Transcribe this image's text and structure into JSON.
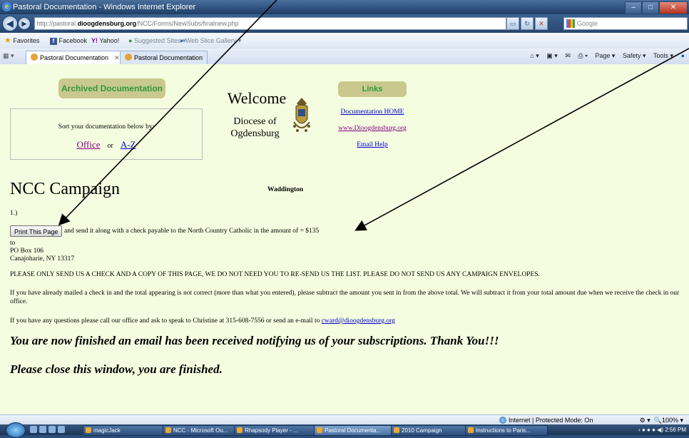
{
  "window": {
    "title": "Pastoral Documentation - Windows Internet Explorer",
    "controls": {
      "minimize": "–",
      "maximize": "□",
      "close": "✕"
    }
  },
  "navbar": {
    "back": "◀",
    "forward": "▶",
    "url_prefix": "http://pastoral.",
    "url_domain": "dioogdensburg.org",
    "url_path": "/NCC/Forms/NewSubs/finalnew.php",
    "search_placeholder": "Google"
  },
  "favorites": {
    "label": "Favorites",
    "items": [
      "Facebook",
      "Yahoo!",
      "Suggested Sites ▾",
      "Web Slice Gallery ▾"
    ]
  },
  "tabs": {
    "items": [
      "Pastoral Documentation",
      "Pastoral Documentation"
    ],
    "tools": [
      "Page ▾",
      "Safety ▾",
      "Tools ▾"
    ]
  },
  "page": {
    "archived_label": "Archived Documentation",
    "sort_label": "Sort your documentation below by:",
    "sort_office": "Office",
    "sort_or": "or",
    "sort_az": "A-Z",
    "welcome": "Welcome",
    "diocese_line1": "Diocese of",
    "diocese_line2": "Ogdensburg",
    "links_label": "Links",
    "link_home": "Documentation HOME",
    "link_site": "www.Dioogdensburg.org",
    "link_email": "Email Help",
    "heading": "NCC Campaign",
    "parish": "Waddington",
    "step": "1.)",
    "print_button": "Print This Page",
    "send_text": "and send it along with a check payable to the North Country Catholic in the amount of = $135",
    "address_to": "to",
    "address_line1": "PO Box 106",
    "address_line2": "Canajoharie, NY 13317",
    "para1": "PLEASE ONLY SEND US A CHECK AND A COPY OF THIS PAGE, WE DO NOT NEED YOU TO RE-SEND US THE LIST.  PLEASE DO NOT SEND US ANY CAMPAIGN ENVELOPES.",
    "para2": "If you have already mailed a check in and the total appearing is not correct (more than what you entered), please subtract the amount you sent in from the above total.  We will subtract it from your total amount due when we receive the check in our office.",
    "para3_prefix": "If you have any questions please call our office and ask to speak to Christine at 315-608-7556 or send an e-mail to ",
    "para3_email": "cward@dioogdensburg.org",
    "finished1": "You are now finished an email has been received notifying us of your subscriptions. Thank You!!!",
    "finished2": "Please close this window, you are finished."
  },
  "statusbar": {
    "zone": "Internet | Protected Mode: On",
    "zoom": "100%"
  },
  "taskbar": {
    "items": [
      "magicJack",
      "NCC - Microsoft Ou...",
      "Rhapsody Player - ...",
      "Pastoral Documenta...",
      "2010 Campaign",
      "Instructions to Paris..."
    ],
    "clock": "2:56 PM"
  }
}
